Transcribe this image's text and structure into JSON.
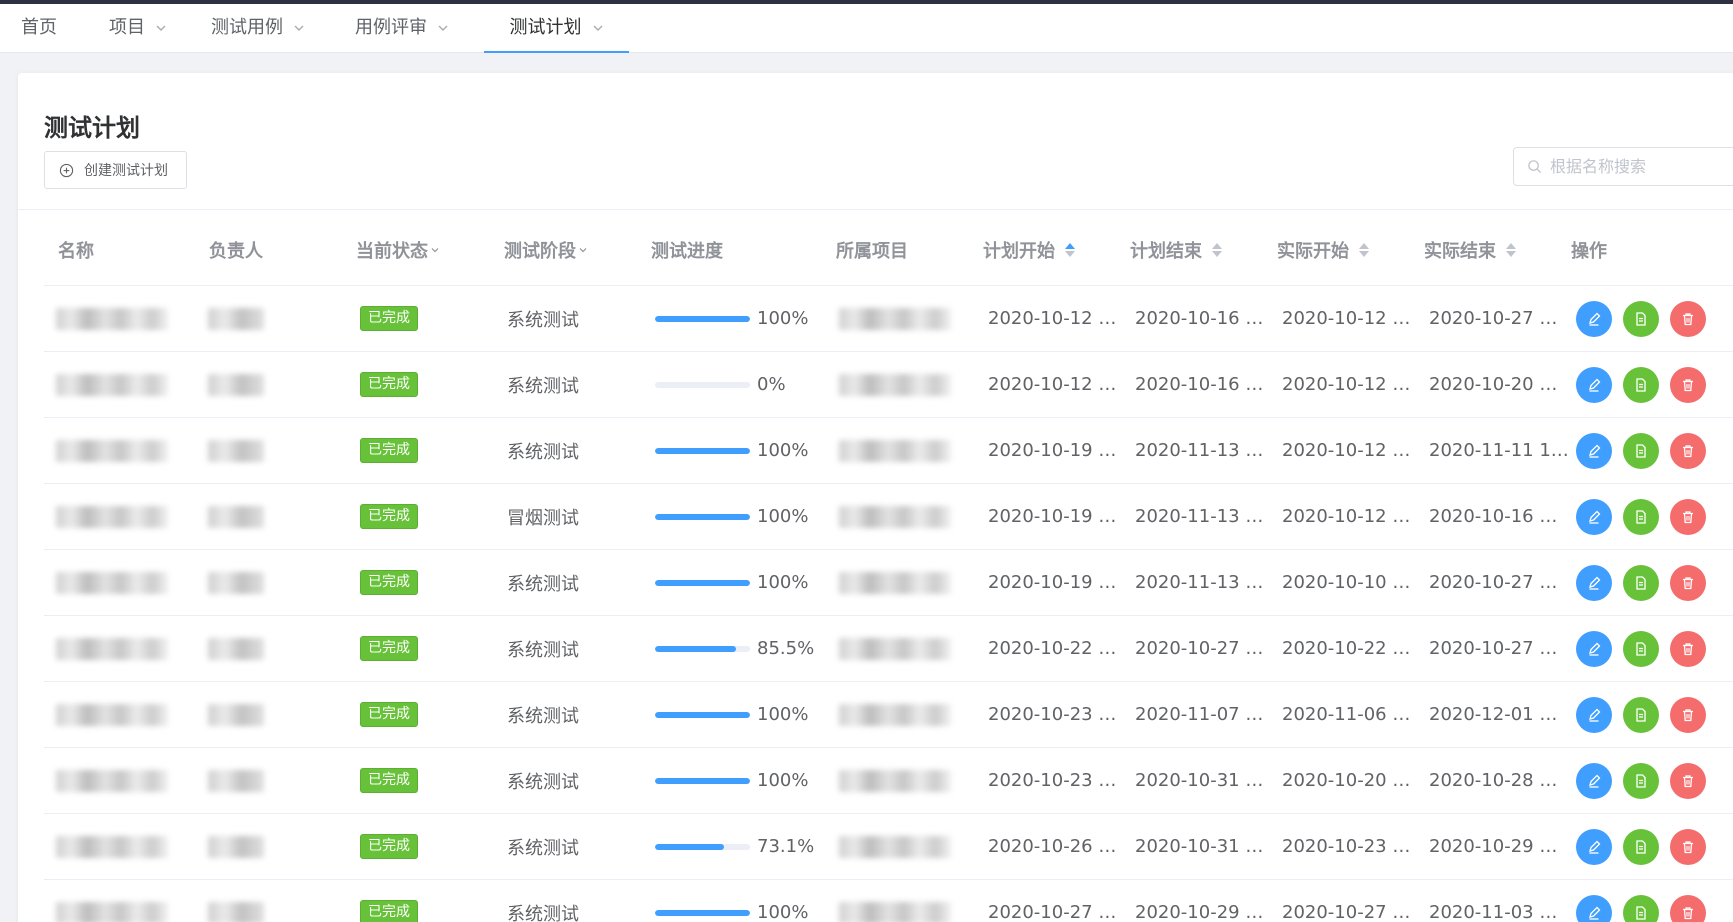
{
  "nav": {
    "items": [
      {
        "label": "首页",
        "has_dropdown": false
      },
      {
        "label": "项目",
        "has_dropdown": true
      },
      {
        "label": "测试用例",
        "has_dropdown": true
      },
      {
        "label": "用例评审",
        "has_dropdown": true
      },
      {
        "label": "测试计划",
        "has_dropdown": true,
        "active": true
      }
    ]
  },
  "page": {
    "title": "测试计划",
    "create_button": "创建测试计划",
    "search_placeholder": "根据名称搜索"
  },
  "colors": {
    "accent": "#409eff",
    "success": "#67c23a",
    "danger": "#f56c6c"
  },
  "table": {
    "columns": [
      {
        "key": "name",
        "label": "名称",
        "filter": false,
        "sortable": false
      },
      {
        "key": "owner",
        "label": "负责人",
        "filter": false,
        "sortable": false
      },
      {
        "key": "status",
        "label": "当前状态",
        "filter": true,
        "sortable": false
      },
      {
        "key": "stage",
        "label": "测试阶段",
        "filter": true,
        "sortable": false
      },
      {
        "key": "progress",
        "label": "测试进度",
        "filter": false,
        "sortable": false
      },
      {
        "key": "project",
        "label": "所属项目",
        "filter": false,
        "sortable": false
      },
      {
        "key": "plan_start",
        "label": "计划开始",
        "filter": false,
        "sortable": true,
        "sort_active": "ascending"
      },
      {
        "key": "plan_end",
        "label": "计划结束",
        "filter": false,
        "sortable": true
      },
      {
        "key": "actual_start",
        "label": "实际开始",
        "filter": false,
        "sortable": true
      },
      {
        "key": "actual_end",
        "label": "实际结束",
        "filter": false,
        "sortable": true
      },
      {
        "key": "actions",
        "label": "操作",
        "filter": false,
        "sortable": false
      }
    ],
    "rows": [
      {
        "status": "已完成",
        "stage": "系统测试",
        "progress": 100,
        "progress_label": "100%",
        "plan_start": "2020-10-12 …",
        "plan_end": "2020-10-16 …",
        "actual_start": "2020-10-12 …",
        "actual_end": "2020-10-27 …"
      },
      {
        "status": "已完成",
        "stage": "系统测试",
        "progress": 0,
        "progress_label": "0%",
        "plan_start": "2020-10-12 …",
        "plan_end": "2020-10-16 …",
        "actual_start": "2020-10-12 …",
        "actual_end": "2020-10-20 …"
      },
      {
        "status": "已完成",
        "stage": "系统测试",
        "progress": 100,
        "progress_label": "100%",
        "plan_start": "2020-10-19 …",
        "plan_end": "2020-11-13 …",
        "actual_start": "2020-10-12 …",
        "actual_end": "2020-11-11 1…"
      },
      {
        "status": "已完成",
        "stage": "冒烟测试",
        "progress": 100,
        "progress_label": "100%",
        "plan_start": "2020-10-19 …",
        "plan_end": "2020-11-13 …",
        "actual_start": "2020-10-12 …",
        "actual_end": "2020-10-16 …"
      },
      {
        "status": "已完成",
        "stage": "系统测试",
        "progress": 100,
        "progress_label": "100%",
        "plan_start": "2020-10-19 …",
        "plan_end": "2020-11-13 …",
        "actual_start": "2020-10-10 …",
        "actual_end": "2020-10-27 …"
      },
      {
        "status": "已完成",
        "stage": "系统测试",
        "progress": 85.5,
        "progress_label": "85.5%",
        "plan_start": "2020-10-22 …",
        "plan_end": "2020-10-27 …",
        "actual_start": "2020-10-22 …",
        "actual_end": "2020-10-27 …"
      },
      {
        "status": "已完成",
        "stage": "系统测试",
        "progress": 100,
        "progress_label": "100%",
        "plan_start": "2020-10-23 …",
        "plan_end": "2020-11-07 …",
        "actual_start": "2020-11-06 …",
        "actual_end": "2020-12-01 …"
      },
      {
        "status": "已完成",
        "stage": "系统测试",
        "progress": 100,
        "progress_label": "100%",
        "plan_start": "2020-10-23 …",
        "plan_end": "2020-10-31 …",
        "actual_start": "2020-10-20 …",
        "actual_end": "2020-10-28 …"
      },
      {
        "status": "已完成",
        "stage": "系统测试",
        "progress": 73.1,
        "progress_label": "73.1%",
        "plan_start": "2020-10-26 …",
        "plan_end": "2020-10-31 …",
        "actual_start": "2020-10-23 …",
        "actual_end": "2020-10-29 …"
      },
      {
        "status": "已完成",
        "stage": "系统测试",
        "progress": 100,
        "progress_label": "100%",
        "plan_start": "2020-10-27 …",
        "plan_end": "2020-10-29 …",
        "actual_start": "2020-10-27 …",
        "actual_end": "2020-11-03 …"
      }
    ]
  }
}
